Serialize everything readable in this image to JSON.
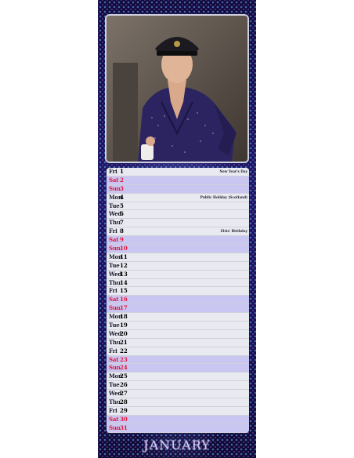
{
  "month": "JANUARY",
  "days": [
    {
      "label": "Fri",
      "num": "1",
      "weekend": false,
      "event": "New Year's Day"
    },
    {
      "label": "Sat",
      "num": "2",
      "weekend": true,
      "event": ""
    },
    {
      "label": "Sun",
      "num": "3",
      "weekend": true,
      "event": ""
    },
    {
      "label": "Mon",
      "num": "4",
      "weekend": false,
      "event": "Public Holiday (Scotland)"
    },
    {
      "label": "Tue",
      "num": "5",
      "weekend": false,
      "event": ""
    },
    {
      "label": "Wed",
      "num": "6",
      "weekend": false,
      "event": ""
    },
    {
      "label": "Thu",
      "num": "7",
      "weekend": false,
      "event": ""
    },
    {
      "label": "Fri",
      "num": "8",
      "weekend": false,
      "event": "Elvis' Birthday"
    },
    {
      "label": "Sat",
      "num": "9",
      "weekend": true,
      "event": ""
    },
    {
      "label": "Sun",
      "num": "10",
      "weekend": true,
      "event": ""
    },
    {
      "label": "Mon",
      "num": "11",
      "weekend": false,
      "event": ""
    },
    {
      "label": "Tue",
      "num": "12",
      "weekend": false,
      "event": ""
    },
    {
      "label": "Wed",
      "num": "13",
      "weekend": false,
      "event": ""
    },
    {
      "label": "Thu",
      "num": "14",
      "weekend": false,
      "event": ""
    },
    {
      "label": "Fri",
      "num": "15",
      "weekend": false,
      "event": ""
    },
    {
      "label": "Sat",
      "num": "16",
      "weekend": true,
      "event": ""
    },
    {
      "label": "Sun",
      "num": "17",
      "weekend": true,
      "event": ""
    },
    {
      "label": "Mon",
      "num": "18",
      "weekend": false,
      "event": ""
    },
    {
      "label": "Tue",
      "num": "19",
      "weekend": false,
      "event": ""
    },
    {
      "label": "Wed",
      "num": "20",
      "weekend": false,
      "event": ""
    },
    {
      "label": "Thu",
      "num": "21",
      "weekend": false,
      "event": ""
    },
    {
      "label": "Fri",
      "num": "22",
      "weekend": false,
      "event": ""
    },
    {
      "label": "Sat",
      "num": "23",
      "weekend": true,
      "event": ""
    },
    {
      "label": "Sun",
      "num": "24",
      "weekend": true,
      "event": ""
    },
    {
      "label": "Mon",
      "num": "25",
      "weekend": false,
      "event": ""
    },
    {
      "label": "Tue",
      "num": "26",
      "weekend": false,
      "event": ""
    },
    {
      "label": "Wed",
      "num": "27",
      "weekend": false,
      "event": ""
    },
    {
      "label": "Thu",
      "num": "28",
      "weekend": false,
      "event": ""
    },
    {
      "label": "Fri",
      "num": "29",
      "weekend": false,
      "event": ""
    },
    {
      "label": "Sat",
      "num": "30",
      "weekend": true,
      "event": ""
    },
    {
      "label": "Sun",
      "num": "31",
      "weekend": true,
      "event": ""
    }
  ],
  "colors": {
    "weekend_text": "#e0183a",
    "weekend_row": "#c9c6f2",
    "weekday_row": "#e9eaf0",
    "background": "#141050"
  }
}
